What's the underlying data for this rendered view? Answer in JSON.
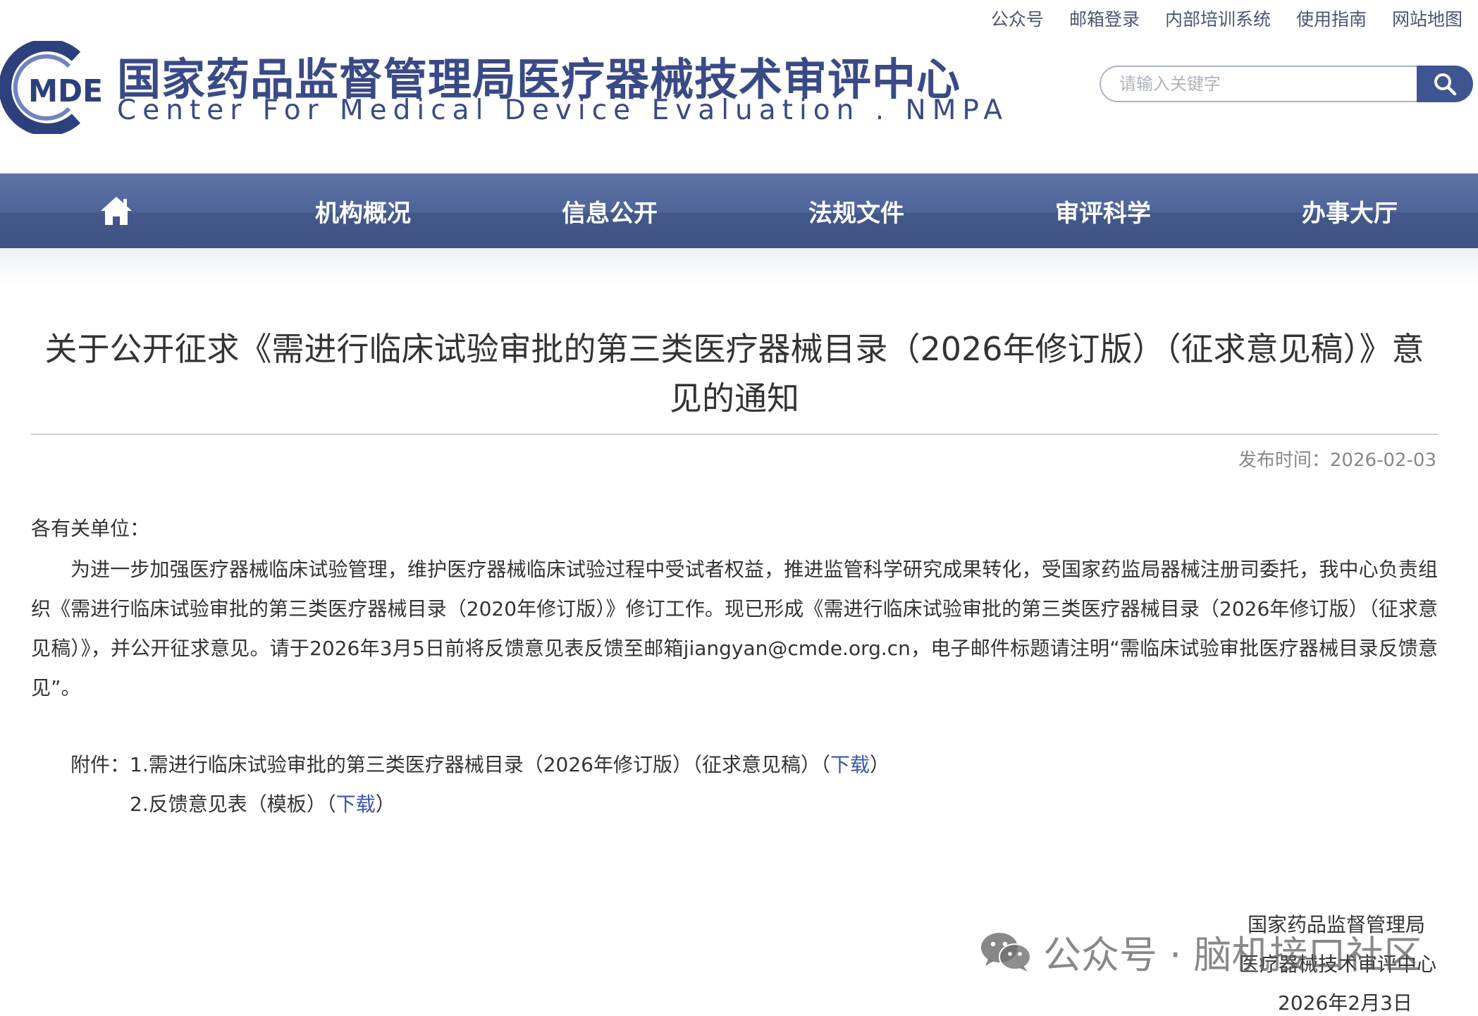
{
  "top_links": [
    "公众号",
    "邮箱登录",
    "内部培训系统",
    "使用指南",
    "网站地图"
  ],
  "header": {
    "logo_text": "MDE",
    "site_title": "国家药品监督管理局医疗器械技术审评中心",
    "site_subtitle": "Center For Medical Device Evaluation . NMPA"
  },
  "search": {
    "placeholder": "请输入关键字",
    "button_icon": "search-icon"
  },
  "nav": {
    "home_icon": "home-icon",
    "items": [
      "机构概况",
      "信息公开",
      "法规文件",
      "审评科学",
      "办事大厅"
    ]
  },
  "article": {
    "title": "关于公开征求《需进行临床试验审批的第三类医疗器械目录（2026年修订版）（征求意见稿）》意见的通知",
    "publish_label": "发布时间：2026-02-03",
    "greeting": "各有关单位：",
    "body": "为进一步加强医疗器械临床试验管理，维护医疗器械临床试验过程中受试者权益，推进监管科学研究成果转化，受国家药监局器械注册司委托，我中心负责组织《需进行临床试验审批的第三类医疗器械目录（2020年修订版）》修订工作。现已形成《需进行临床试验审批的第三类医疗器械目录（2026年修订版）（征求意见稿）》，并公开征求意见。请于2026年3月5日前将反馈意见表反馈至邮箱jiangyan@cmde.org.cn，电子邮件标题请注明“需临床试验审批医疗器械目录反馈意见”。",
    "attachment_label": "附件：",
    "attachments": [
      {
        "text": "1.需进行临床试验审批的第三类医疗器械目录（2026年修订版）（征求意见稿）（",
        "link": "下载",
        "close": "）"
      },
      {
        "text": "2.反馈意见表（模板）（",
        "link": "下载",
        "close": "）"
      }
    ],
    "signature": [
      "国家药品监督管理局",
      "医疗器械技术审评中心",
      "2026年2月3日"
    ]
  },
  "watermark": {
    "icon": "wechat-icon",
    "text": "公众号 · 脑机接口社区"
  }
}
